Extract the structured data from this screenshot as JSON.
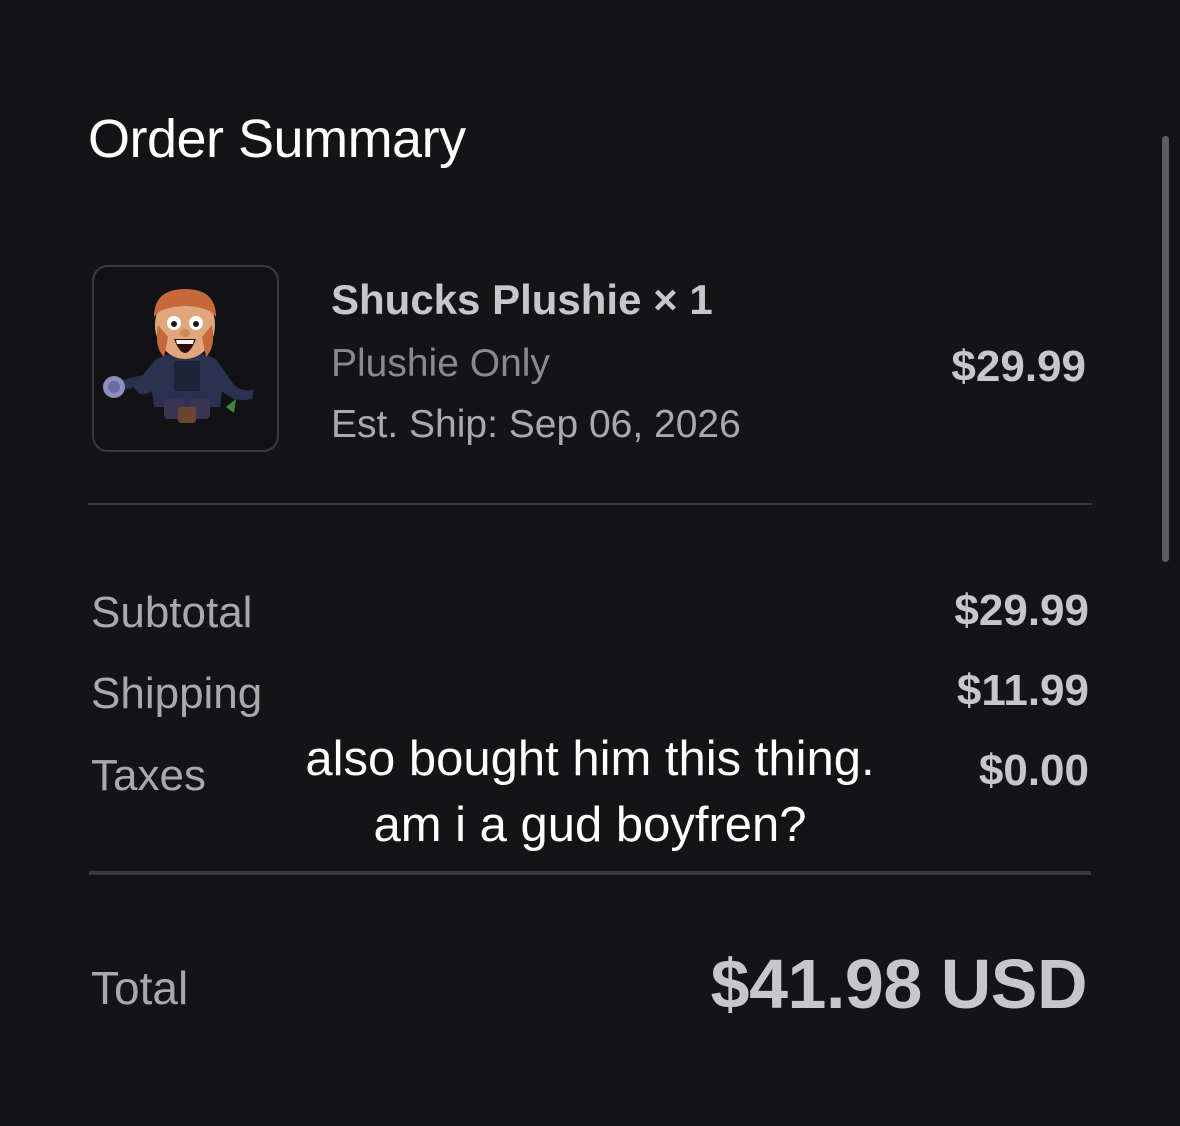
{
  "header": {
    "title": "Order Summary"
  },
  "item": {
    "name": "Shucks Plushie × 1",
    "variant": "Plushie Only",
    "ship": "Est. Ship: Sep 06, 2026",
    "price": "$29.99",
    "thumbnail_icon": "plushie-thumbnail"
  },
  "summary": {
    "subtotal_label": "Subtotal",
    "subtotal_value": "$29.99",
    "shipping_label": "Shipping",
    "shipping_value": "$11.99",
    "taxes_label": "Taxes",
    "taxes_value": "$0.00"
  },
  "total": {
    "label": "Total",
    "value": "$41.98 USD"
  },
  "caption": {
    "line1": "also bought him this thing.",
    "line2": "am i a gud boyfren?"
  },
  "colors": {
    "background": "#141416",
    "divider": "#3a3a3e",
    "text_primary": "#c7c7c9",
    "text_secondary": "#a9a9ac",
    "text_muted": "#8a8a8e"
  }
}
